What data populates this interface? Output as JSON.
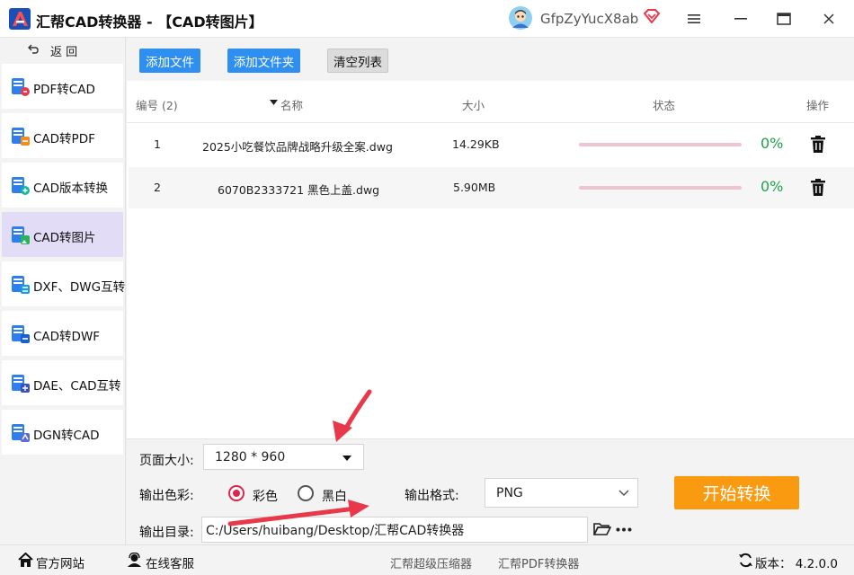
{
  "app": {
    "title": "汇帮CAD转换器 - 【CAD转图片】",
    "username": "GfpZyYucX8ab"
  },
  "sidebar": {
    "back_label": "返 回",
    "items": [
      {
        "label": "PDF转CAD",
        "active": false
      },
      {
        "label": "CAD转PDF",
        "active": false
      },
      {
        "label": "CAD版本转换",
        "active": false
      },
      {
        "label": "CAD转图片",
        "active": true
      },
      {
        "label": "DXF、DWG互转",
        "active": false
      },
      {
        "label": "CAD转DWF",
        "active": false
      },
      {
        "label": "DAE、CAD互转",
        "active": false
      },
      {
        "label": "DGN转CAD",
        "active": false
      }
    ]
  },
  "toolbar": {
    "add_file": "添加文件",
    "add_folder": "添加文件夹",
    "clear_list": "清空列表"
  },
  "table": {
    "columns": {
      "index": "编号 (2)",
      "name": "名称",
      "size": "大小",
      "status": "状态",
      "action": "操作"
    },
    "rows": [
      {
        "index": "1",
        "name": "2025小吃餐饮品牌战略升级全案.dwg",
        "size": "14.29KB",
        "progress": 0,
        "percent": "0%"
      },
      {
        "index": "2",
        "name": "6070B2333721 黑色上盖.dwg",
        "size": "5.90MB",
        "progress": 0,
        "percent": "0%"
      }
    ]
  },
  "options": {
    "page_size_label": "页面大小:",
    "page_size_value": "1280 * 960",
    "color_label": "输出色彩:",
    "color_option": "彩色",
    "bw_option": "黑白",
    "color_selected": "彩色",
    "format_label": "输出格式:",
    "format_value": "PNG",
    "output_dir_label": "输出目录:",
    "output_dir_value": "C:/Users/huibang/Desktop/汇帮CAD转换器",
    "start_button": "开始转换"
  },
  "footer": {
    "website": "官方网站",
    "support": "在线客服",
    "compressor": "汇帮超级压缩器",
    "pdf_converter": "汇帮PDF转换器",
    "version": "版本： 4.2.0.0"
  },
  "colors": {
    "accent_blue": "#2f8ff0",
    "start_orange": "#fa9a10",
    "active_nav": "#e2dcf7",
    "percent_green": "#1ea34a",
    "radio_red": "#e0244c",
    "arrow_red": "#e8394a"
  }
}
